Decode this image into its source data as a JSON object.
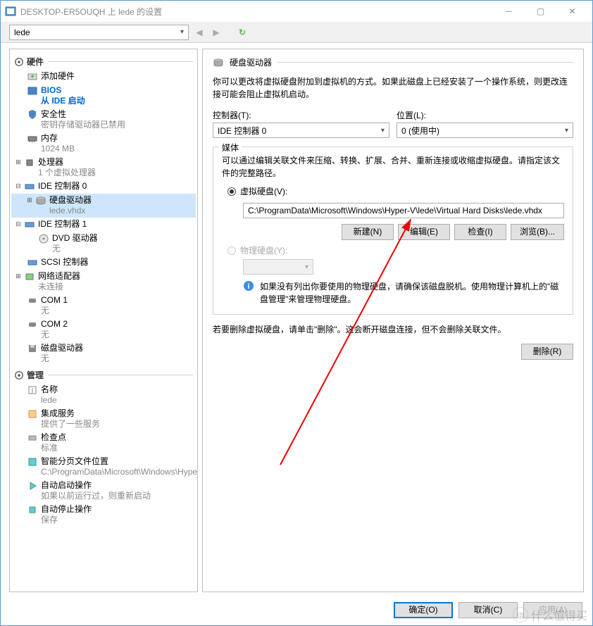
{
  "titlebar": {
    "title": "DESKTOP-ER5OUQH 上 lede 的设置"
  },
  "toolbar": {
    "vm_name": "lede"
  },
  "sidebar": {
    "hardware_label": "硬件",
    "management_label": "管理",
    "items": {
      "add_hw": "添加硬件",
      "bios": "BIOS",
      "bios_sub": "从 IDE 启动",
      "security": "安全性",
      "security_sub": "密钥存储驱动器已禁用",
      "memory": "内存",
      "memory_sub": "1024 MB",
      "cpu": "处理器",
      "cpu_sub": "1 个虚拟处理器",
      "ide0": "IDE 控制器 0",
      "hdd": "硬盘驱动器",
      "hdd_sub": "lede.vhdx",
      "ide1": "IDE 控制器 1",
      "dvd": "DVD 驱动器",
      "dvd_sub": "无",
      "scsi": "SCSI 控制器",
      "nic": "网络适配器",
      "nic_sub": "未连接",
      "com1": "COM 1",
      "com1_sub": "无",
      "com2": "COM 2",
      "com2_sub": "无",
      "floppy": "磁盘驱动器",
      "floppy_sub": "无",
      "name": "名称",
      "name_sub": "lede",
      "integration": "集成服务",
      "integration_sub": "提供了一些服务",
      "checkpoint": "检查点",
      "checkpoint_sub": "标准",
      "smartpaging": "智能分页文件位置",
      "smartpaging_sub": "C:\\ProgramData\\Microsoft\\Windows\\Hype...",
      "autostart": "自动启动操作",
      "autostart_sub": "如果以前运行过，则重新启动",
      "autostop": "自动停止操作",
      "autostop_sub": "保存"
    }
  },
  "main": {
    "title": "硬盘驱动器",
    "desc": "你可以更改将虚拟硬盘附加到虚拟机的方式。如果此磁盘上已经安装了一个操作系统，则更改连接可能会阻止虚拟机启动。",
    "controller_label": "控制器(T):",
    "controller_value": "IDE 控制器 0",
    "location_label": "位置(L):",
    "location_value": "0 (使用中)",
    "media_label": "媒体",
    "media_desc": "可以通过编辑关联文件来压缩、转换、扩展、合并、重新连接或收缩虚拟硬盘。请指定该文件的完整路径。",
    "vhd_radio": "虚拟硬盘(V):",
    "vhd_path": "C:\\ProgramData\\Microsoft\\Windows\\Hyper-V\\lede\\Virtual Hard Disks\\lede.vhdx",
    "btn_new": "新建(N)",
    "btn_edit": "编辑(E)",
    "btn_inspect": "检查(I)",
    "btn_browse": "浏览(B)...",
    "phys_radio": "物理硬盘(Y):",
    "phys_info": "如果没有列出你要使用的物理硬盘，请确保该磁盘脱机。使用物理计算机上的\"磁盘管理\"来管理物理硬盘。",
    "delete_note": "若要删除虚拟硬盘，请单击\"删除\"。这会断开磁盘连接，但不会删除关联文件。",
    "btn_delete": "删除(R)"
  },
  "footer": {
    "ok": "确定(O)",
    "cancel": "取消(C)",
    "apply": "应用(A)"
  },
  "watermark": {
    "text": "什么值得买",
    "badge": "值"
  }
}
